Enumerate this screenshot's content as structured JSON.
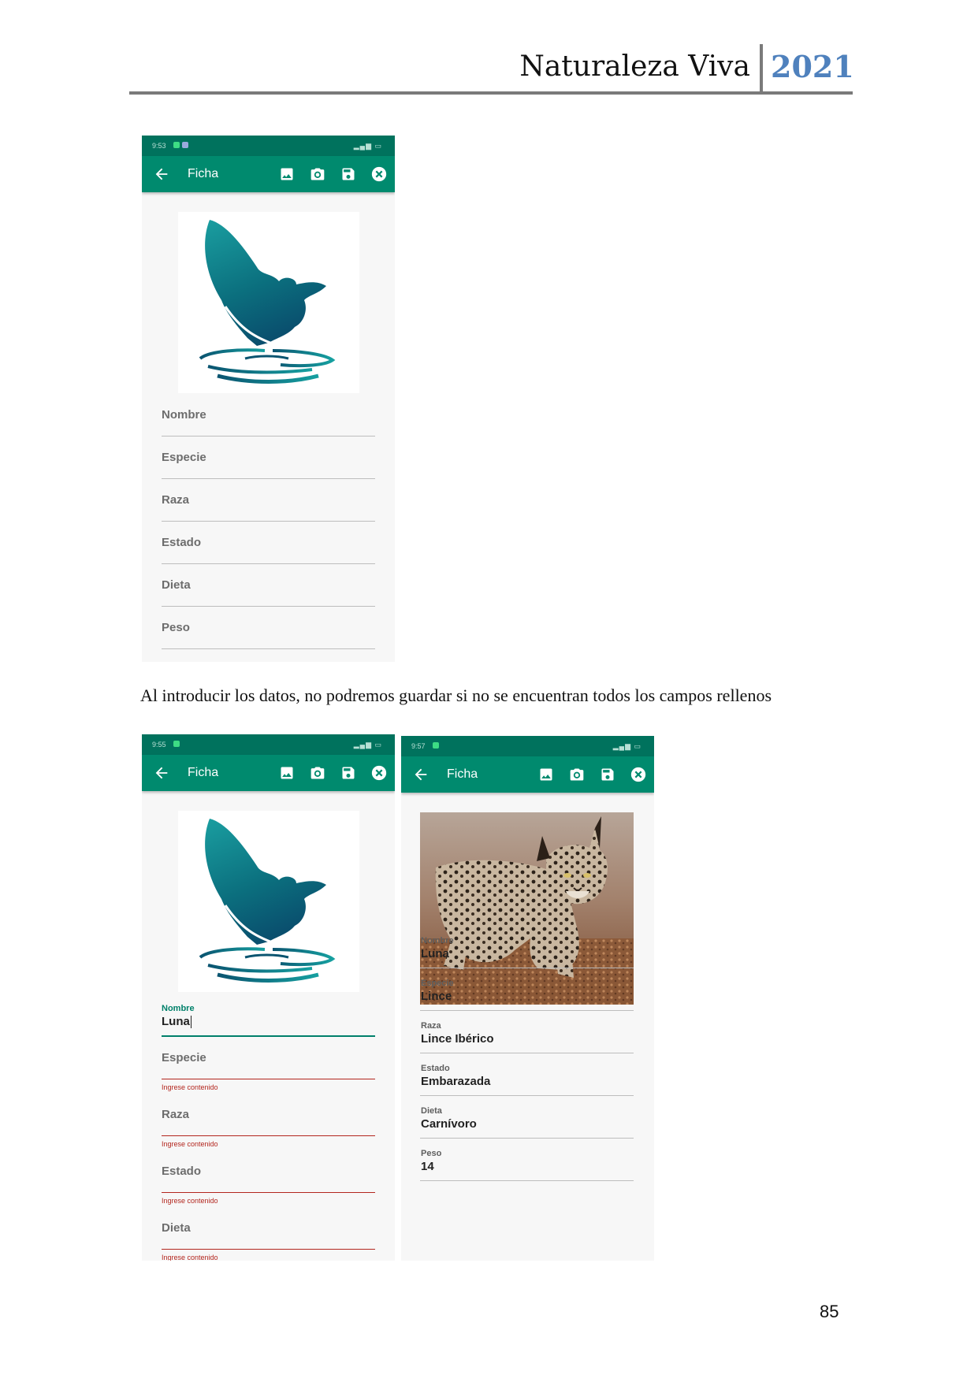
{
  "header": {
    "title": "Naturaleza Viva",
    "year": "2021"
  },
  "caption": "Al introducir los datos, no podremos guardar si no se encuentran todos los campos rellenos",
  "page_number": "85",
  "colors": {
    "status_bar": "#00725d",
    "app_bar": "#008a6e",
    "accent_year": "#4f81bd",
    "error": "#b3261e"
  },
  "screens": [
    {
      "status_time": "9:53",
      "app_title": "Ficha",
      "actions": [
        "image-icon",
        "camera-icon",
        "save-icon",
        "close-icon"
      ],
      "fields": [
        "Nombre",
        "Especie",
        "Raza",
        "Estado",
        "Dieta",
        "Peso"
      ]
    },
    {
      "status_time": "9:55",
      "app_title": "Ficha",
      "nombre_label": "Nombre",
      "nombre_value": "Luna",
      "fields": [
        "Especie",
        "Raza",
        "Estado",
        "Dieta"
      ],
      "error": "Ingrese contenido"
    },
    {
      "status_time": "9:57",
      "app_title": "Ficha",
      "fields": [
        {
          "label": "Nombre",
          "value": "Luna"
        },
        {
          "label": "Especie",
          "value": "Lince"
        },
        {
          "label": "Raza",
          "value": "Lince Ibérico"
        },
        {
          "label": "Estado",
          "value": "Embarazada"
        },
        {
          "label": "Dieta",
          "value": "Carnívoro"
        },
        {
          "label": "Peso",
          "value": "14"
        }
      ]
    }
  ]
}
